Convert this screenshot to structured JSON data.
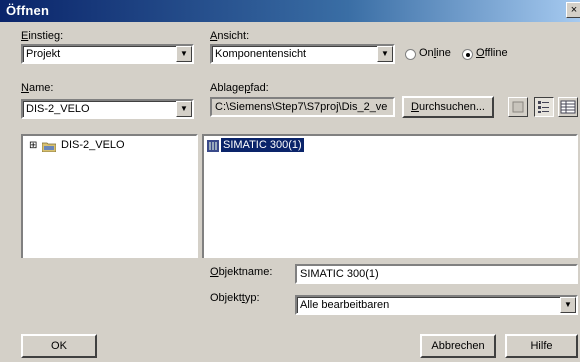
{
  "window": {
    "title": "Öffnen",
    "close_glyph": "×"
  },
  "einstieg": {
    "label_u": "E",
    "label_rest": "instieg:",
    "value": "Projekt"
  },
  "ansicht": {
    "label_u": "A",
    "label_rest": "nsicht:",
    "value": "Komponentensicht"
  },
  "mode": {
    "online": {
      "pre": "On",
      "u": "l",
      "post": "ine",
      "selected": false
    },
    "offline": {
      "pre": "",
      "u": "O",
      "post": "ffline",
      "selected": true
    }
  },
  "name": {
    "label_u": "N",
    "label_rest": "ame:",
    "value": "DIS-2_VELO"
  },
  "ablagepfad": {
    "label_pre": "Ablage",
    "label_u": "p",
    "label_post": "fad:",
    "value": "C:\\Siemens\\Step7\\S7proj\\Dis_2_ve"
  },
  "durchsuchen": {
    "u": "D",
    "rest": "urchsuchen..."
  },
  "tree": {
    "expander": "⊞",
    "item": "DIS-2_VELO"
  },
  "list": {
    "item": "SIMATIC 300(1)"
  },
  "objektname": {
    "label_u": "O",
    "label_rest": "bjektname:",
    "value": "SIMATIC 300(1)"
  },
  "objekttyp": {
    "label_pre": "Objekt",
    "label_u": "t",
    "label_post": "yp:",
    "value": "Alle bearbeitbaren"
  },
  "buttons": {
    "ok": "OK",
    "abbrechen": "Abbrechen",
    "hilfe": "Hilfe"
  }
}
